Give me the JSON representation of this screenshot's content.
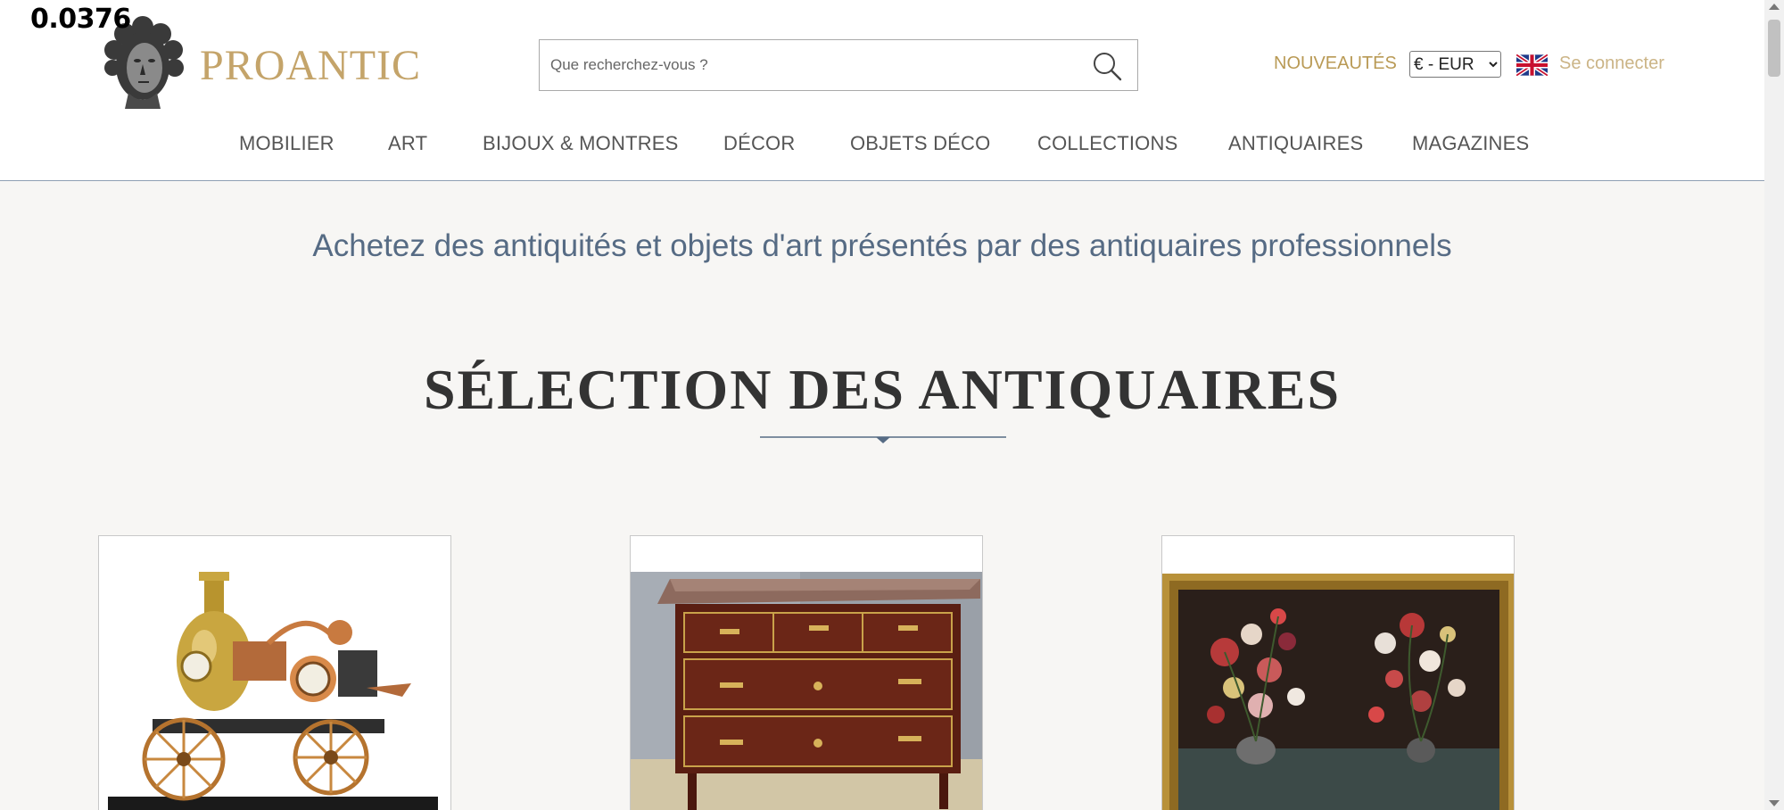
{
  "overlay": {
    "value": "0.0376"
  },
  "brand": {
    "name": "PROANTIC",
    "color": "#c4a46a"
  },
  "search": {
    "placeholder": "Que recherchez-vous ?",
    "value": "",
    "icon": "search-icon"
  },
  "header": {
    "new_label": "NOUVEAUTÉS",
    "currency_selected": "€ - EUR",
    "language_icon": "uk-flag-icon",
    "login_label": "Se connecter"
  },
  "nav": {
    "items": [
      {
        "label": "MOBILIER"
      },
      {
        "label": "ART"
      },
      {
        "label": "BIJOUX & MONTRES"
      },
      {
        "label": "DÉCOR"
      },
      {
        "label": "OBJETS DÉCO"
      },
      {
        "label": "COLLECTIONS"
      },
      {
        "label": "ANTIQUAIRES"
      },
      {
        "label": "MAGAZINES"
      }
    ]
  },
  "hero": {
    "tagline": "Achetez des antiquités et objets d'art présentés par des antiquaires professionnels",
    "section_title": "SÉLECTION DES ANTIQUAIRES"
  },
  "products": [
    {
      "image": "steam-engine-clock-image"
    },
    {
      "image": "mahogany-commode-image"
    },
    {
      "image": "flower-still-life-painting-image"
    }
  ],
  "colors": {
    "accent": "#c4a46a",
    "nav_text": "#555555",
    "tagline": "#566b84",
    "background": "#f7f6f4"
  }
}
